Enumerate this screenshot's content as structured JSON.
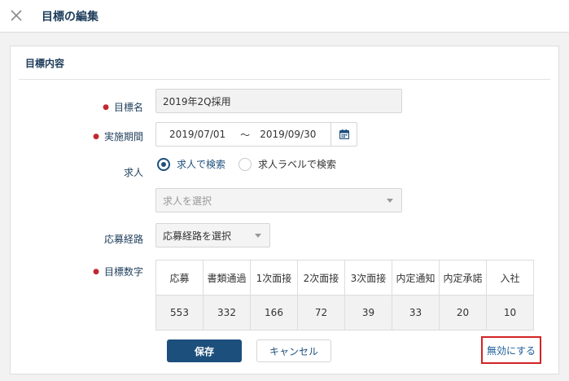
{
  "header": {
    "title": "目標の編集",
    "close_icon": "close-icon"
  },
  "form": {
    "section_title": "目標内容",
    "goal_name": {
      "label": "目標名",
      "required": true,
      "value": "2019年2Q採用"
    },
    "period": {
      "label": "実施期間",
      "required": true,
      "start": "2019/07/01",
      "separator": "〜",
      "end": "2019/09/30",
      "icon": "calendar-icon"
    },
    "job": {
      "label": "求人",
      "required": false,
      "options": [
        {
          "label": "求人で検索",
          "selected": true
        },
        {
          "label": "求人ラベルで検索",
          "selected": false
        }
      ],
      "select_placeholder": "求人を選択"
    },
    "route": {
      "label": "応募経路",
      "required": false,
      "value": "応募経路を選択"
    },
    "targets": {
      "label": "目標数字",
      "required": true,
      "headers": [
        "応募",
        "書類通過",
        "1次面接",
        "2次面接",
        "3次面接",
        "内定通知",
        "内定承諾",
        "入社"
      ],
      "values": [
        "553",
        "332",
        "166",
        "72",
        "39",
        "33",
        "20",
        "10"
      ]
    }
  },
  "actions": {
    "save": "保存",
    "cancel": "キャンセル",
    "disable": "無効にする"
  },
  "colors": {
    "primary": "#1d4f7c",
    "required": "#c0282e",
    "highlight_border": "#d32424"
  }
}
